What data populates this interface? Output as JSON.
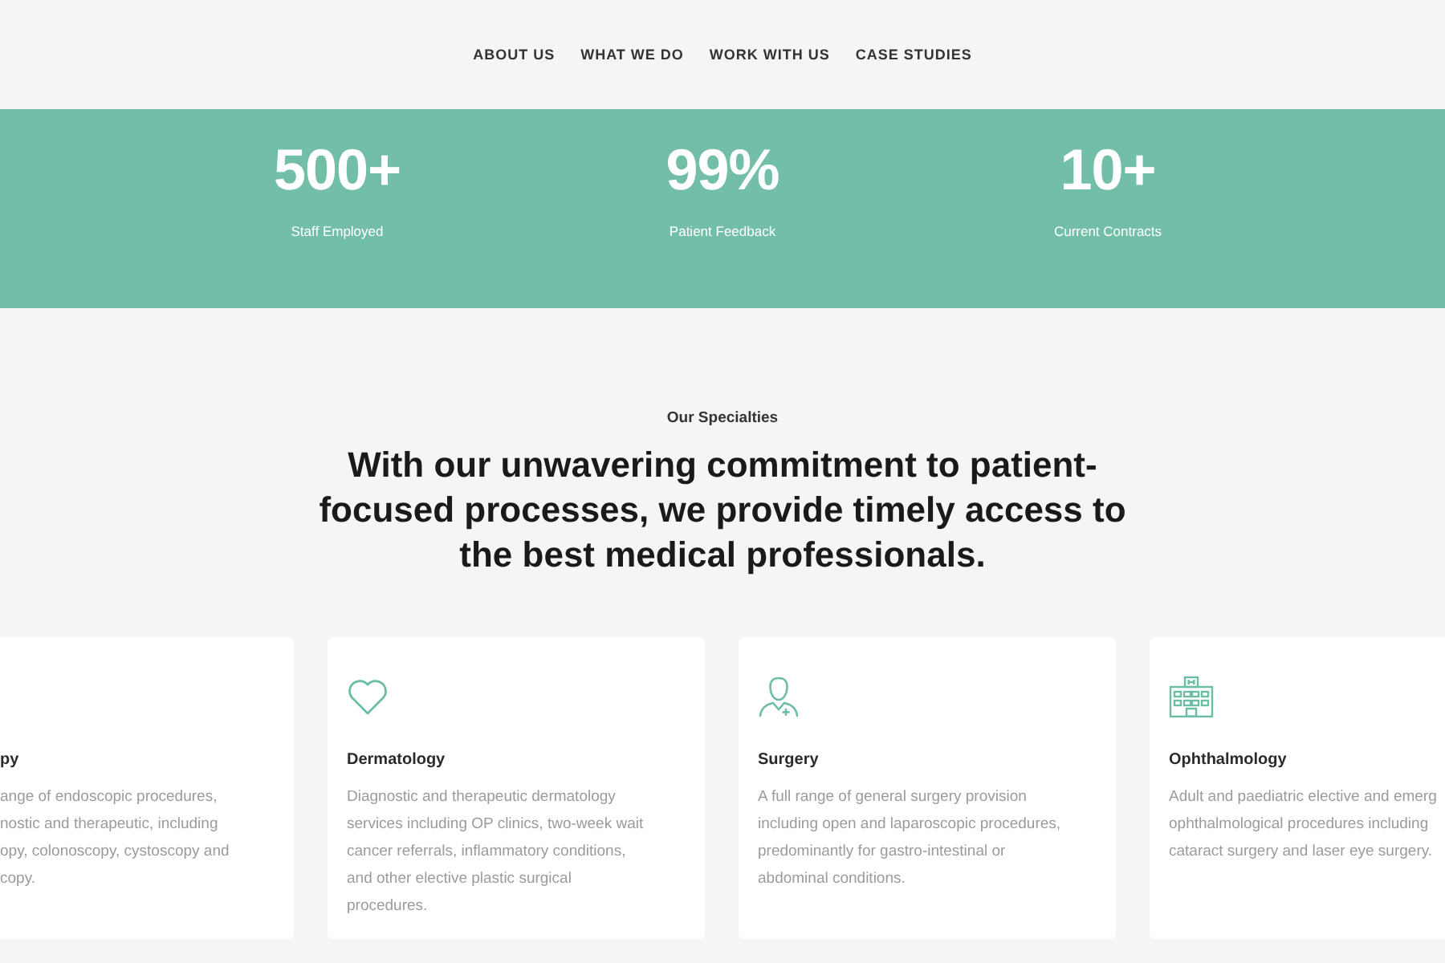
{
  "nav": {
    "links": [
      "ABOUT US",
      "WHAT WE DO",
      "WORK WITH US",
      "CASE STUDIES"
    ]
  },
  "stats": [
    {
      "value": "500+",
      "label": "Staff Employed"
    },
    {
      "value": "99%",
      "label": "Patient Feedback"
    },
    {
      "value": "10+",
      "label": "Current Contracts"
    }
  ],
  "specialties": {
    "eyebrow": "Our Specialties",
    "heading": "With our unwavering commitment to patient-focused processes, we provide timely access to the best medical professionals.",
    "cards": [
      {
        "kind": "cut-left",
        "title": "py",
        "lines": [
          "ange of endoscopic procedures,",
          "nostic and therapeutic, including",
          "opy, colonoscopy, cystoscopy and",
          "copy."
        ]
      },
      {
        "kind": "whole",
        "title": "Dermatology",
        "description": "Diagnostic and therapeutic dermatology services including OP clinics, two-week wait cancer referrals, inflammatory conditions, and other elective plastic surgical procedures."
      },
      {
        "kind": "whole",
        "title": "Surgery",
        "description": "A full range of general surgery provision including open and laparoscopic procedures, predominantly for gastro-intestinal or abdominal conditions."
      },
      {
        "kind": "cut-right",
        "title": "Ophthalmology",
        "lines": [
          "Adult and paediatric elective and emerg",
          "ophthalmological procedures including",
          "cataract surgery and laser eye surgery."
        ]
      }
    ]
  }
}
